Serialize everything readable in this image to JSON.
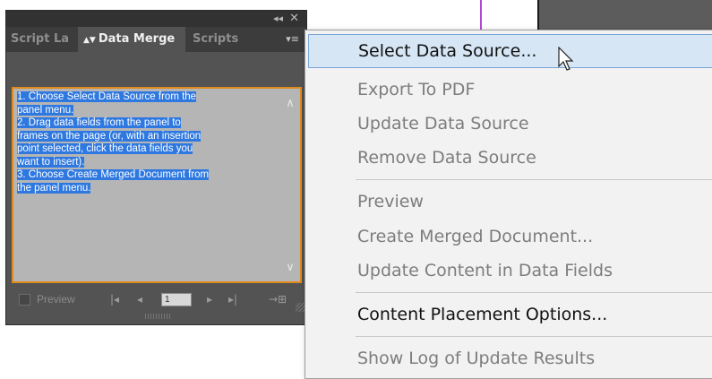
{
  "panel": {
    "titlebar": {
      "collapse_icon": "double-chevron-left-icon",
      "close_icon": "close-icon"
    },
    "tabs": [
      {
        "label": "Script La"
      },
      {
        "label": "Data Merge",
        "icon": "spin-arrows-icon"
      },
      {
        "label": "Scripts"
      }
    ],
    "menu_icon": "panel-menu-icon",
    "instructions": [
      "1. Choose Select Data Source from the",
      "panel menu.",
      "2. Drag data fields from the panel to",
      "frames on the page (or, with an insertion",
      "point selected, click the data fields you",
      "want to insert).",
      "3. Choose Create Merged Document from",
      "the panel menu."
    ],
    "footer": {
      "preview_label": "Preview",
      "record_value": "1"
    }
  },
  "menu": {
    "items": [
      {
        "label": "Select Data Source...",
        "enabled": true,
        "selected": true
      },
      {
        "label": "Export To PDF",
        "enabled": false
      },
      {
        "label": "Update Data Source",
        "enabled": false
      },
      {
        "label": "Remove Data Source",
        "enabled": false
      },
      {
        "label": "Preview",
        "enabled": false
      },
      {
        "label": "Create Merged Document...",
        "enabled": false
      },
      {
        "label": "Update Content in Data Fields",
        "enabled": false
      },
      {
        "label": "Content Placement Options...",
        "enabled": true
      },
      {
        "label": "Show Log of Update Results",
        "enabled": false
      }
    ]
  },
  "colors": {
    "selection": "#2e78e0",
    "menu_hover": "#d6e6f5",
    "focus_border": "#e08a1e",
    "panel_bg": "#535353"
  }
}
